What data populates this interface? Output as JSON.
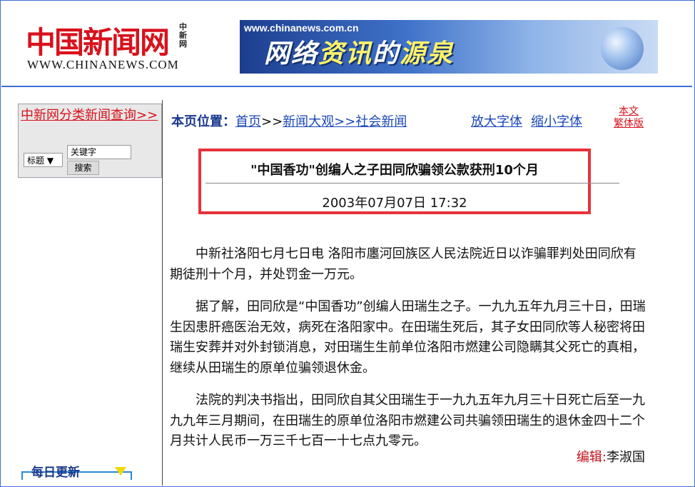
{
  "header": {
    "logo_cn": "中国新闻网",
    "logo_small": "中新网",
    "logo_url": "WWW.CHINANEWS.COM",
    "banner_url": "www.chinanews.com.cn",
    "banner_slogan_1": "网络",
    "banner_slogan_2": "资讯",
    "banner_slogan_3": "的",
    "banner_slogan_4": "源泉"
  },
  "sidebar": {
    "category_link": "中新网分类新闻查询>>",
    "select_value": "标题",
    "keyword_placeholder": "关键字",
    "search_button": "搜索",
    "daily_update": "每日更新"
  },
  "breadcrumb": {
    "label": "本页位置：",
    "home": "首页",
    "sep1": ">>",
    "section": "新闻大观",
    "sep2": ">>",
    "subsection": "社会新闻"
  },
  "font_controls": {
    "enlarge": "放大字体",
    "shrink": "缩小字体",
    "traditional_1": "本文",
    "traditional_2": "繁体版"
  },
  "article": {
    "title": "\"中国香功\"创编人之子田同欣骗领公款获刑10个月",
    "datetime": "2003年07月07日 17:32",
    "paragraphs": [
      "中新社洛阳七月七日电 洛阳市廛河回族区人民法院近日以诈骗罪判处田同欣有期徒刑十个月，并处罚金一万元。",
      "据了解，田同欣是“中国香功”创编人田瑞生之子。一九九五年九月三十日，田瑞生因患肝癌医治无效，病死在洛阳家中。在田瑞生死后，其子女田同欣等人秘密将田瑞生安葬并对外封锁消息，对田瑞生生前单位洛阳市燃建公司隐瞒其父死亡的真相，继续从田瑞生的原单位骗领退休金。",
      "法院的判决书指出，田同欣自其父田瑞生于一九九五年九月三十日死亡后至一九九九年三月期间，在田瑞生的原单位洛阳市燃建公司共骗领田瑞生的退休金四十二个月共计人民币一万三千七百一十七点九零元。"
    ],
    "editor_label": "编辑:",
    "editor_name": "李淑国"
  },
  "colors": {
    "brand_red": "#d8121c",
    "link_blue": "#1a47b8",
    "frame_blue": "#3d6fd6",
    "highlight_box": "#e8323b"
  }
}
